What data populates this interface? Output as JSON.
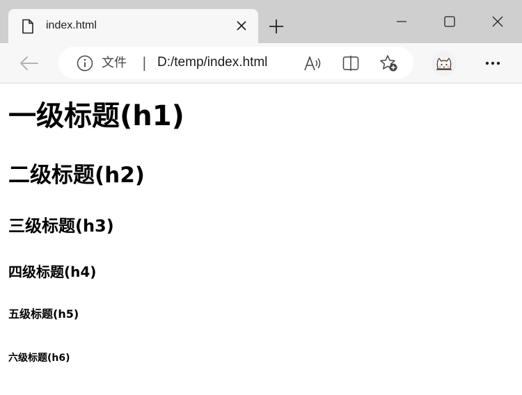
{
  "tab": {
    "title": "index.html",
    "icon": "file-icon"
  },
  "toolbar": {
    "site_label": "文件",
    "separator": "|",
    "url": "D:/temp/index.html"
  },
  "page": {
    "headings": {
      "h1": "一级标题(h1)",
      "h2": "二级标题(h2)",
      "h3": "三级标题(h3)",
      "h4": "四级标题(h4)",
      "h5": "五级标题(h5)",
      "h6": "六级标题(h6)"
    }
  },
  "colors": {
    "tabstrip_bg": "#cfcfcf",
    "toolbar_bg": "#f7f7f7",
    "page_bg": "#ffffff",
    "text": "#000000"
  }
}
